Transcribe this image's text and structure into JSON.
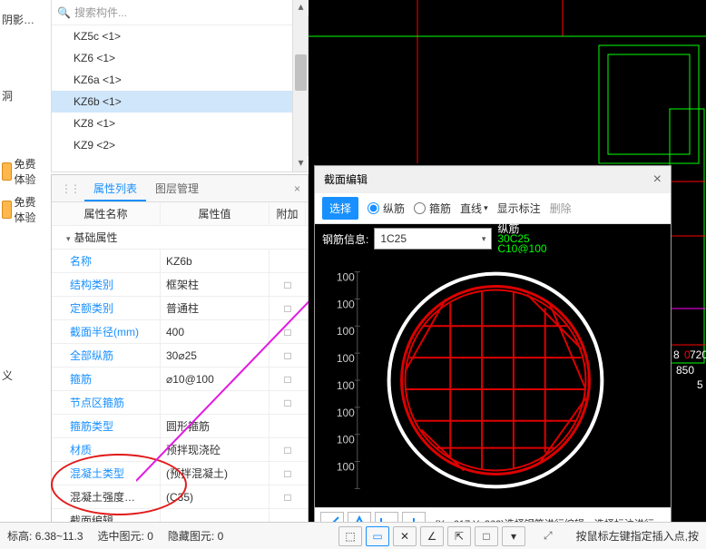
{
  "left_sidebar": {
    "items": [
      "阴影…",
      "",
      "洞",
      "",
      "免费体验",
      "免费体验",
      "",
      "",
      "义",
      ""
    ]
  },
  "tree": {
    "search_placeholder": "搜索构件...",
    "items": [
      {
        "label": "KZ5c <1>"
      },
      {
        "label": "KZ6  <1>"
      },
      {
        "label": "KZ6a  <1>"
      },
      {
        "label": "KZ6b  <1>",
        "selected": true
      },
      {
        "label": "KZ8  <1>"
      },
      {
        "label": "KZ9  <2>"
      }
    ]
  },
  "props": {
    "tabs": [
      "属性列表",
      "图层管理"
    ],
    "headers": [
      "属性名称",
      "属性值",
      "附加"
    ],
    "group": "基础属性",
    "rows": [
      {
        "k": "名称",
        "v": "KZ6b",
        "e": ""
      },
      {
        "k": "结构类别",
        "v": "框架柱",
        "e": "□"
      },
      {
        "k": "定额类别",
        "v": "普通柱",
        "e": "□"
      },
      {
        "k": "截面半径(mm)",
        "v": "400",
        "e": "□"
      },
      {
        "k": "全部纵筋",
        "v": "30⌀25",
        "e": "□"
      },
      {
        "k": "箍筋",
        "v": "⌀10@100",
        "e": "□"
      },
      {
        "k": "节点区箍筋",
        "v": "",
        "e": "□"
      },
      {
        "k": "箍筋类型",
        "v": "圆形箍筋",
        "e": ""
      },
      {
        "k": "材质",
        "v": "预拌现浇砼",
        "e": "□"
      },
      {
        "k": "混凝土类型",
        "v": "(预拌混凝土)",
        "e": "□"
      },
      {
        "k": "混凝土强度…",
        "v": "(C35)",
        "e": "□",
        "black": true
      },
      {
        "k": "截面编辑",
        "v": "",
        "e": "",
        "black": true
      }
    ]
  },
  "section": {
    "title": "截面编辑",
    "select": "选择",
    "radio1": "纵筋",
    "radio2": "箍筋",
    "tool_line": "直线",
    "tool_show": "显示标注",
    "tool_del": "删除",
    "info_label": "钢筋信息:",
    "combo_value": "1C25",
    "side_top": "纵筋",
    "side_v1": "30C25",
    "side_v2": "C10@100",
    "status_text": "(X: -617 Y: 362)选择钢筋进行编辑，选择标注进行"
  },
  "chart_data": {
    "type": "section",
    "shape": "circle",
    "radius": 400,
    "grid_spacing": 100,
    "axis_ticks": [
      100,
      100,
      100,
      100,
      100,
      100,
      100,
      100
    ],
    "longitudinal_bars": {
      "count": 30,
      "spec": "C25"
    },
    "stirrups": {
      "spec": "C10",
      "spacing": 100,
      "shape": "圆形箍筋"
    }
  },
  "canvas_labels": {
    "a": "720",
    "b": "850",
    "c": "5"
  },
  "bottom": {
    "elev_label": "标高:",
    "elev_value": "6.38~11.3",
    "sel_label": "选中图元:",
    "sel_value": "0",
    "hid_label": "隐藏图元:",
    "hid_value": "0",
    "hint": "按鼠标左键指定插入点,按"
  }
}
